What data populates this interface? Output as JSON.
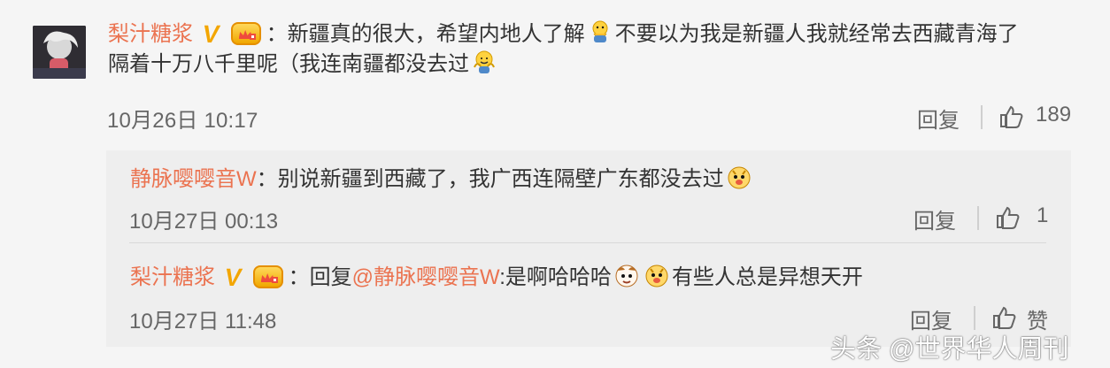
{
  "comment": {
    "username": "梨汁糖浆",
    "separator": "：",
    "text_part1": "新疆真的很大，希望内地人了解",
    "text_part2": "不要以为我是新疆人我就经常去西藏青海了",
    "text_part3": "隔着十万八千里呢（我连南疆都没去过",
    "time": "10月26日 10:17",
    "reply_label": "回复",
    "like_count": "189"
  },
  "replies": [
    {
      "username": "静脉嘤嘤音W",
      "separator": "：",
      "text": "别说新疆到西藏了，我广西连隔壁广东都没去过",
      "time": "10月27日 00:13",
      "reply_label": "回复",
      "like_count": "1"
    },
    {
      "username": "梨汁糖浆",
      "separator": "：",
      "prefix": "回复",
      "mention": "@静脉嘤嘤音W",
      "text_part1": ":是啊哈哈哈",
      "text_part2": "有些人总是异想天开",
      "time": "10月27日 11:48",
      "reply_label": "回复",
      "like_label": "赞"
    }
  ],
  "watermark": "头条 @世界华人周刊",
  "icons": {
    "verified": "verified-v-icon",
    "member": "member-crown-icon",
    "like": "thumbs-up-icon",
    "emoji1": "yellow-face-icon",
    "emoji2": "shrug-face-icon",
    "emoji3": "doge-face-icon",
    "emoji4": "dog-face-icon"
  },
  "colors": {
    "accent": "#eb7350",
    "badge": "#f3a600",
    "background": "#f5f5f5",
    "reply_background": "#eeeeee"
  }
}
